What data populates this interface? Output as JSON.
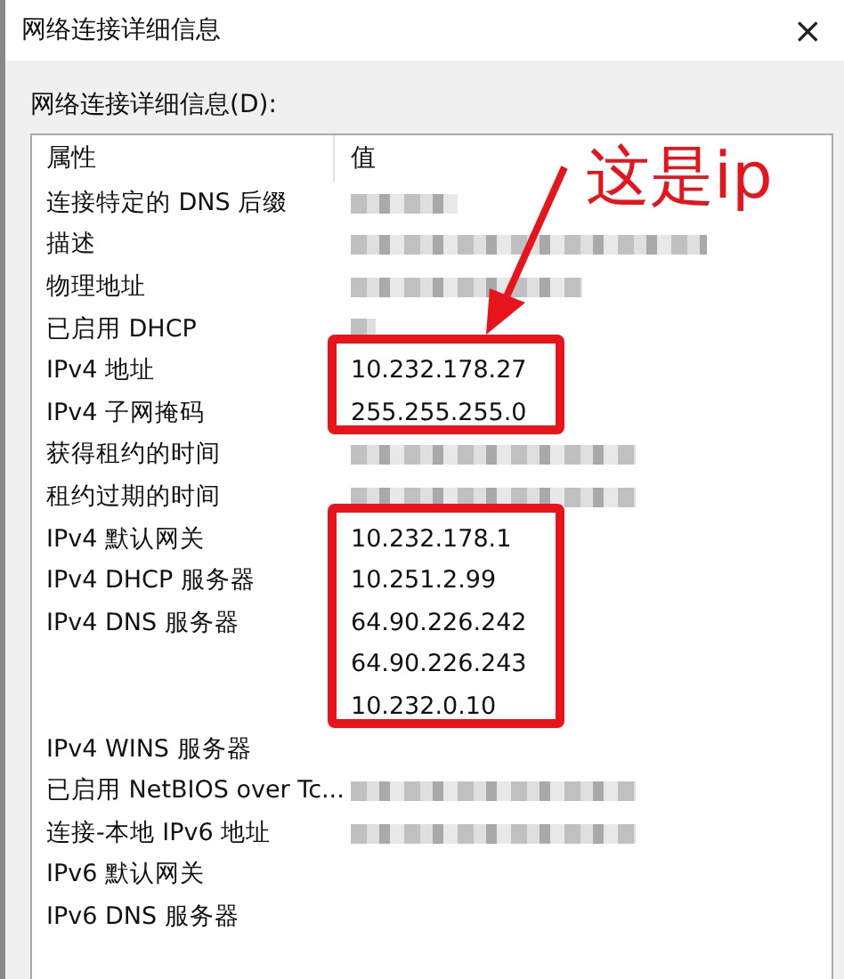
{
  "window": {
    "title": "网络连接详细信息",
    "close": "×"
  },
  "list_label": "网络连接详细信息(D):",
  "table": {
    "columns": [
      "属性",
      "值"
    ],
    "rows": [
      {
        "property": "连接特定的 DNS 后缀",
        "redacted": true,
        "boxed": false
      },
      {
        "property": "描述",
        "redacted": true,
        "boxed": false
      },
      {
        "property": "物理地址",
        "redacted": true,
        "boxed": false
      },
      {
        "property": "已启用 DHCP",
        "redacted": true,
        "boxed": false
      },
      {
        "property": "IPv4 地址",
        "value": "10.232.178.27",
        "redacted": false,
        "boxed": true
      },
      {
        "property": "IPv4 子网掩码",
        "value": "255.255.255.0",
        "redacted": false,
        "boxed": true
      },
      {
        "property": "获得租约的时间",
        "redacted": true,
        "boxed": false
      },
      {
        "property": "租约过期的时间",
        "redacted": true,
        "boxed": false
      },
      {
        "property": "IPv4 默认网关",
        "value": "10.232.178.1",
        "redacted": false,
        "boxed": true
      },
      {
        "property": "IPv4 DHCP 服务器",
        "value": "10.251.2.99",
        "redacted": false,
        "boxed": true
      },
      {
        "property": "IPv4 DNS 服务器",
        "value": "64.90.226.242",
        "redacted": false,
        "boxed": true
      },
      {
        "value": "64.90.226.243",
        "redacted": false,
        "boxed": true
      },
      {
        "value": "10.232.0.10",
        "redacted": false,
        "boxed": true
      },
      {
        "property": "IPv4 WINS 服务器",
        "redacted": false,
        "boxed": false
      },
      {
        "property": "已启用 NetBIOS over Tc...",
        "redacted": true,
        "boxed": false
      },
      {
        "property": "连接-本地 IPv6 地址",
        "redacted": true,
        "boxed": false
      },
      {
        "property": "IPv6 默认网关",
        "redacted": false,
        "boxed": false
      },
      {
        "property": "IPv6 DNS 服务器",
        "redacted": false,
        "boxed": false
      }
    ]
  },
  "annotation": {
    "text": "这是ip"
  }
}
